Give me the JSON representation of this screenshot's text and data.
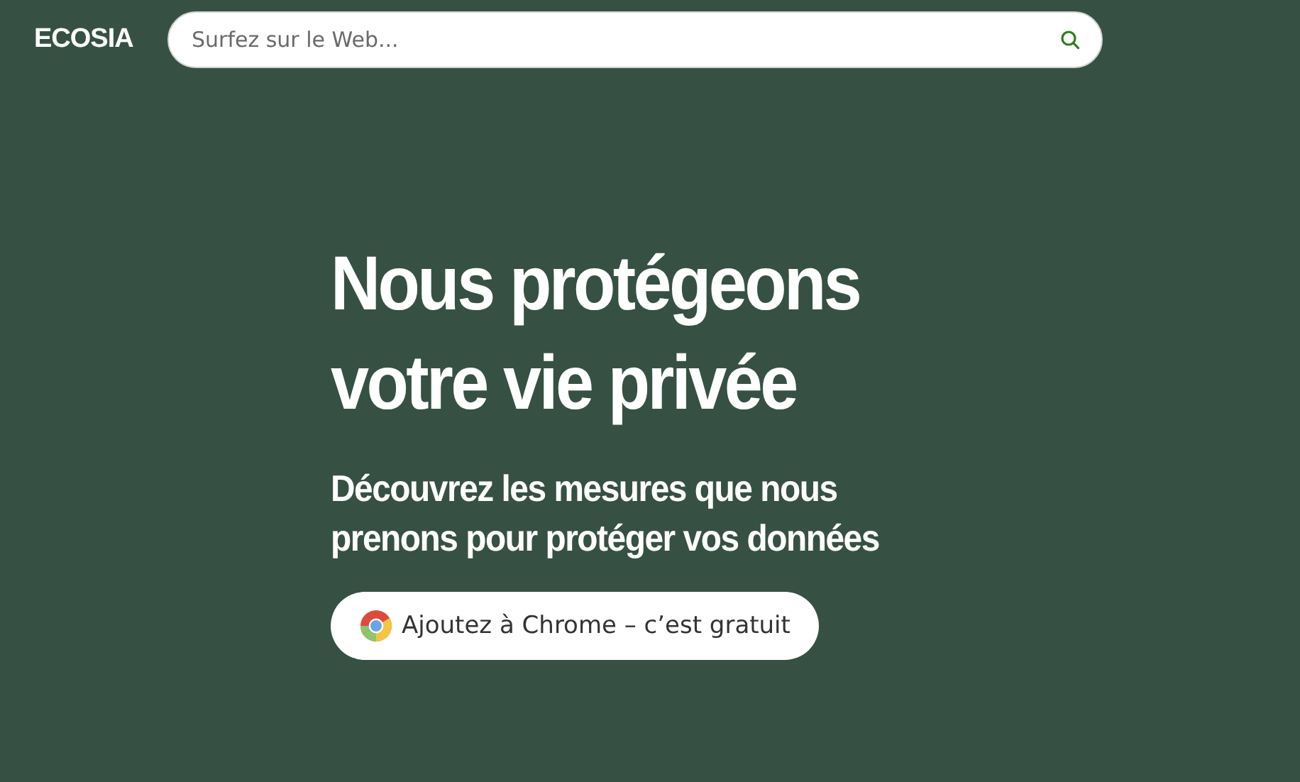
{
  "header": {
    "logo": "ECOSIA",
    "search": {
      "placeholder": "Surfez sur le Web..."
    }
  },
  "hero": {
    "title_lines": [
      "Nous protégeons",
      "votre vie privée"
    ],
    "subtitle_lines": [
      "Découvrez les mesures que nous",
      "prenons pour protéger vos données"
    ],
    "button": "Ajoutez à Chrome – c’est gratuit"
  }
}
